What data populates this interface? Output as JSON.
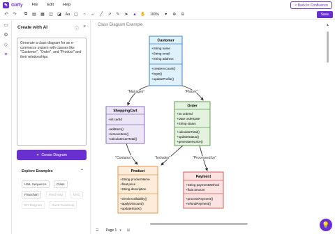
{
  "app": {
    "name": "Gliffy",
    "menus": [
      "File",
      "Edit",
      "Help"
    ],
    "back_label": "< Back to Confluence",
    "save_label": "Save"
  },
  "toolbar": {
    "zoom": "100%"
  },
  "panel": {
    "title": "Create with AI",
    "prompt": "Generate a class diagram for an e-commerce system with classes like \"Customer\", \"Order\", and \"Product\" and their relationships.",
    "generate_label": "Create Diagram",
    "examples_title": "Explore Examples",
    "examples": [
      "UML Sequence",
      "Class",
      "Flowchart",
      "Mind Map",
      "ERD",
      "ER Diagram",
      "Gantt Roadmap"
    ]
  },
  "canvas": {
    "title": "Class Diagram Example"
  },
  "classes": {
    "customer": {
      "name": "Customer",
      "attributes": [
        "+String name",
        "+String email",
        "+String address"
      ],
      "methods": [
        "+createAccount()",
        "+login()",
        "+updateProfile()"
      ]
    },
    "cart": {
      "name": "ShoppingCart",
      "attributes": [
        "+int cartId"
      ],
      "methods": [
        "+addItem()",
        "+removeItem()",
        "+calculateCartTotal()"
      ]
    },
    "order": {
      "name": "Order",
      "attributes": [
        "+int orderId",
        "+Date orderDate",
        "+String status"
      ],
      "methods": [
        "+calculateTotal()",
        "+updateStatus()",
        "+generateInvoice()"
      ]
    },
    "product": {
      "name": "Product",
      "attributes": [
        "+String productName",
        "+float price",
        "+String description"
      ],
      "methods": [
        "+checkAvailability()",
        "+applyDiscount()",
        "+updateStock()"
      ]
    },
    "payment": {
      "name": "Payment",
      "attributes": [
        "+String paymentMethod",
        "+float amount"
      ],
      "methods": [
        "+processPayment()",
        "+refundPayment()"
      ]
    }
  },
  "relations": {
    "manages": "\"Manages\"",
    "places": "\"Places\"",
    "contains": "\"Contains\"",
    "includes": "\"Includes\"",
    "processed": "\"Processed by\""
  },
  "footer": {
    "page_label": "Page 1"
  },
  "colors": {
    "accent": "#6a2fd1",
    "customer_fill": "#dff1fb",
    "customer_border": "#3a83c7",
    "cart_fill": "#ece5f6",
    "cart_border": "#8e6fc2",
    "order_fill": "#e3f3df",
    "order_border": "#5f9e4e",
    "product_fill": "#fdecd9",
    "product_border": "#e2954a",
    "payment_fill": "#fce3e1",
    "payment_border": "#d05a56"
  }
}
